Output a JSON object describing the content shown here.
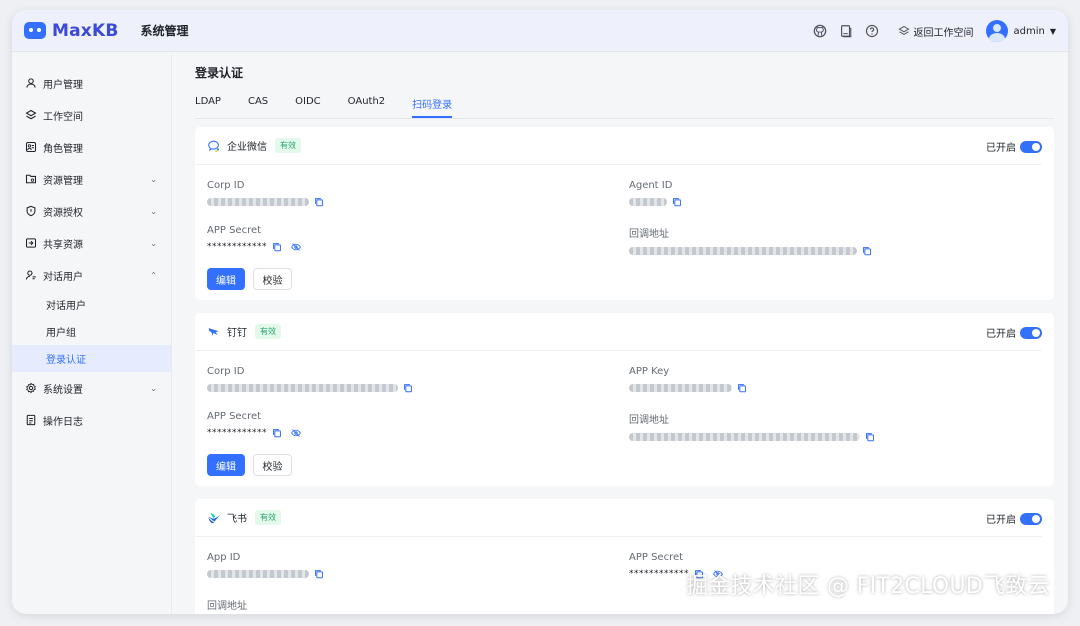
{
  "header": {
    "logo_text": "MaxKB",
    "title": "系统管理",
    "back_workspace": "返回工作空间",
    "user_name": "admin"
  },
  "sidebar": {
    "items": [
      {
        "label": "用户管理",
        "icon": "user-icon"
      },
      {
        "label": "工作空间",
        "icon": "layers-icon"
      },
      {
        "label": "角色管理",
        "icon": "role-icon"
      },
      {
        "label": "资源管理",
        "icon": "folder-icon"
      },
      {
        "label": "资源授权",
        "icon": "shield-icon"
      },
      {
        "label": "共享资源",
        "icon": "share-icon"
      },
      {
        "label": "对话用户",
        "icon": "chat-user-icon"
      }
    ],
    "sub_items": [
      "对话用户",
      "用户组",
      "登录认证"
    ],
    "tail_items": [
      {
        "label": "系统设置",
        "icon": "gear-icon"
      },
      {
        "label": "操作日志",
        "icon": "log-icon"
      }
    ]
  },
  "main": {
    "title": "登录认证",
    "tabs": [
      "LDAP",
      "CAS",
      "OIDC",
      "OAuth2",
      "扫码登录"
    ],
    "active_tab": "扫码登录"
  },
  "common": {
    "enabled_label": "已开启",
    "valid_badge": "有效",
    "edit_button": "编辑",
    "verify_button": "校验",
    "masked_secret": "************"
  },
  "cards": [
    {
      "title": "企业微信",
      "icon": "wecom-icon",
      "fields": [
        {
          "label": "Corp ID"
        },
        {
          "label": "Agent ID"
        },
        {
          "label": "APP Secret"
        },
        {
          "label": "回调地址"
        }
      ]
    },
    {
      "title": "钉钉",
      "icon": "dingtalk-icon",
      "fields": [
        {
          "label": "Corp ID"
        },
        {
          "label": "APP Key"
        },
        {
          "label": "APP Secret"
        },
        {
          "label": "回调地址"
        }
      ]
    },
    {
      "title": "飞书",
      "icon": "feishu-icon",
      "fields": [
        {
          "label": "App ID"
        },
        {
          "label": "APP Secret"
        },
        {
          "label": "回调地址"
        }
      ]
    }
  ],
  "watermark": "掘金技术社区 @ FIT2CLOUD飞致云",
  "colors": {
    "accent": "#3370ff",
    "badge_green": "#2ba471"
  }
}
